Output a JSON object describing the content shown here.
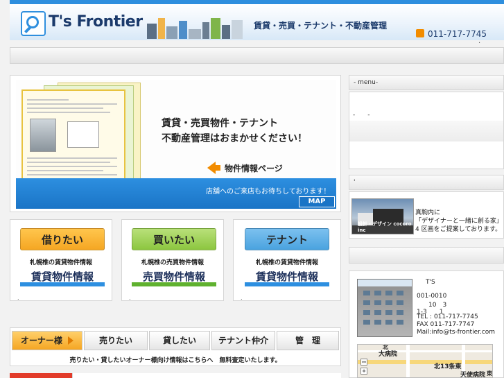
{
  "header": {
    "logo_text": "T's Frontier",
    "tagline": "賃貸・売買・テナント・不動産管理",
    "phone": "011-717-7745",
    "top_dot": "."
  },
  "hero": {
    "copy_line1": "賃貸・売買物件・テナント",
    "copy_line2": "不動産管理はおまかせください！",
    "link_label": "物件情報ページ",
    "notice": "店舗へのご来店もお待ちしております！",
    "map_label": "MAP"
  },
  "categories": [
    {
      "button": "借りたい",
      "sub": "札幌椎の賃貸物件情報",
      "big": "賃貸物件情報",
      "dot": ".",
      "color": "#f5a623"
    },
    {
      "button": "買いたい",
      "sub": "札幌椎の売買物件情報",
      "big": "売買物件情報",
      "dot": ".",
      "color": "#8cc63f"
    },
    {
      "button": "テナント",
      "sub": "札幌椎の賃貸物件情報",
      "big": "賃貸物件情報",
      "dot": ".",
      "color": "#4aa3df"
    }
  ],
  "owner_nav": {
    "items": [
      "オーナー様",
      "売りたい",
      "貸したい",
      "テナント仲介",
      "管　理"
    ],
    "note": "売りたい・貸したいオーナー様向け情報はこちらへ　無料査定いたします。"
  },
  "sidebar": {
    "menu_title": "- menu-",
    "menu_item": "-　　-",
    "section_dot": "'",
    "ad_logo": "設計・デザイン cocoro inc",
    "ad_lines": [
      "真駒内に",
      "「デザイナーと一緒に創る家」",
      "4 区画をご提案しております。"
    ],
    "company": {
      "name": "T'S",
      "postal": "001-0010",
      "addr1": "10　3",
      "addr2": "1-3　　1",
      "tel": "TEL : 011-717-7745",
      "fax": "FAX 011-717-7747",
      "mail": "Mail:info@ts-frontier.com"
    },
    "map_labels": [
      "大病院",
      "北13条東",
      "天使病院",
      "北",
      "東"
    ]
  },
  "colors": {
    "accent_blue": "#2d8fe0",
    "orange": "#f28c00",
    "red": "#e23b2a"
  }
}
